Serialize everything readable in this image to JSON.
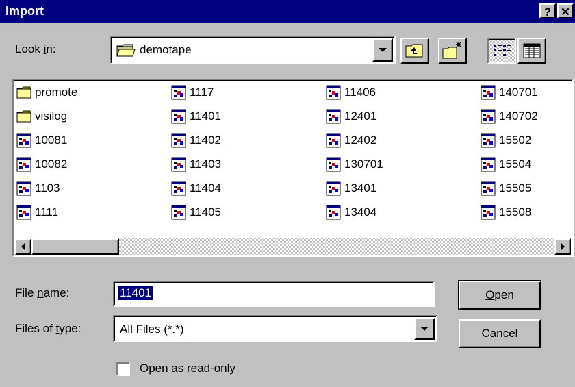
{
  "window": {
    "title": "Import",
    "help_button": "?",
    "close_button": "✕"
  },
  "look_in": {
    "label_pre": "Look ",
    "label_key": "i",
    "label_post": "n:",
    "value": "demotape"
  },
  "toolbar": {
    "icons": [
      "up-one-level-icon",
      "create-new-folder-icon",
      "list-view-icon",
      "details-view-icon"
    ]
  },
  "files": [
    {
      "name": "promote",
      "type": "folder"
    },
    {
      "name": "visilog",
      "type": "folder"
    },
    {
      "name": "10081",
      "type": "file"
    },
    {
      "name": "10082",
      "type": "file"
    },
    {
      "name": "1103",
      "type": "file"
    },
    {
      "name": "1111",
      "type": "file"
    },
    {
      "name": "1117",
      "type": "file"
    },
    {
      "name": "11401",
      "type": "file"
    },
    {
      "name": "11402",
      "type": "file"
    },
    {
      "name": "11403",
      "type": "file"
    },
    {
      "name": "11404",
      "type": "file"
    },
    {
      "name": "11405",
      "type": "file"
    },
    {
      "name": "11406",
      "type": "file"
    },
    {
      "name": "12401",
      "type": "file"
    },
    {
      "name": "12402",
      "type": "file"
    },
    {
      "name": "130701",
      "type": "file"
    },
    {
      "name": "13401",
      "type": "file"
    },
    {
      "name": "13404",
      "type": "file"
    },
    {
      "name": "140701",
      "type": "file"
    },
    {
      "name": "140702",
      "type": "file"
    },
    {
      "name": "15502",
      "type": "file"
    },
    {
      "name": "15504",
      "type": "file"
    },
    {
      "name": "15505",
      "type": "file"
    },
    {
      "name": "15508",
      "type": "file"
    }
  ],
  "file_name": {
    "label_pre": "File ",
    "label_key": "n",
    "label_post": "ame:",
    "value": "11401"
  },
  "file_type": {
    "label_pre": "Files of ",
    "label_key": "t",
    "label_post": "ype:",
    "value": "All Files (*.*)"
  },
  "buttons": {
    "open_key": "O",
    "open_rest": "pen",
    "cancel": "Cancel"
  },
  "read_only": {
    "label_pre": "Open as ",
    "label_key": "r",
    "label_post": "ead-only",
    "checked": false
  },
  "colors": {
    "titlebar": "#000080",
    "face": "#c0c0c0",
    "selection": "#000080"
  }
}
